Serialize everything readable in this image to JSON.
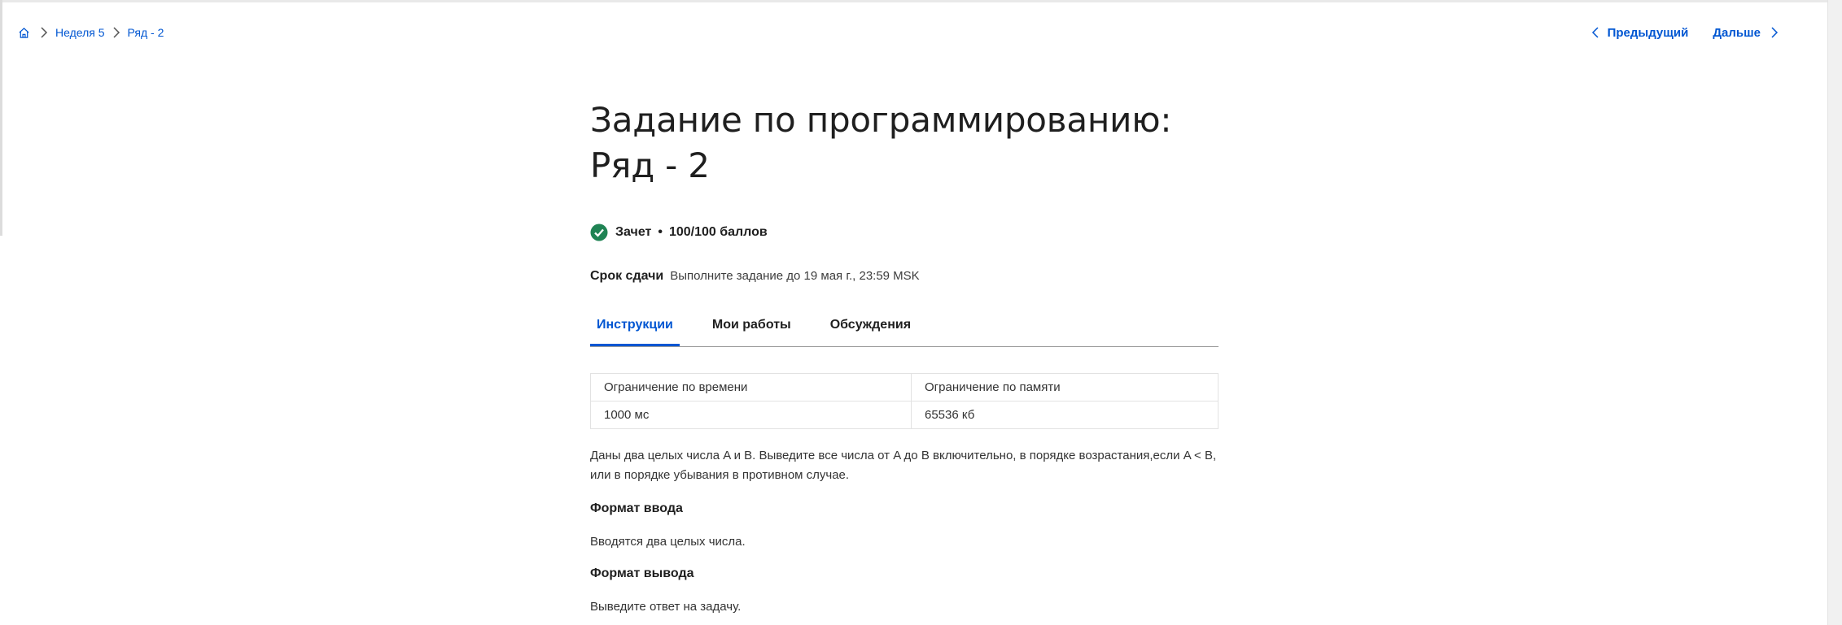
{
  "breadcrumb": {
    "home_icon": "home-icon",
    "items": [
      "Неделя 5",
      "Ряд - 2"
    ]
  },
  "pager": {
    "prev_label": "Предыдущий",
    "next_label": "Дальше"
  },
  "title": "Задание по программированию: Ряд - 2",
  "status": {
    "icon": "check-circle-icon",
    "label": "Зачет",
    "separator": "•",
    "score": "100/100 баллов"
  },
  "deadline": {
    "label": "Срок сдачи",
    "value": "Выполните задание до 19 мая г., 23:59 MSK"
  },
  "tabs": [
    {
      "label": "Инструкции",
      "active": true
    },
    {
      "label": "Мои работы",
      "active": false
    },
    {
      "label": "Обсуждения",
      "active": false
    }
  ],
  "limits": {
    "headers": [
      "Ограничение по времени",
      "Ограничение по памяти"
    ],
    "values": [
      "1000 мс",
      "65536 кб"
    ]
  },
  "description": "Даны два целых числа A и B. Выведите все числа от A до B включительно, в порядке возрастания,если A < B, или в порядке убывания в противном случае.",
  "input_format": {
    "heading": "Формат ввода",
    "text": "Вводятся два целых числа."
  },
  "output_format": {
    "heading": "Формат вывода",
    "text": "Выведите ответ на задачу."
  },
  "colors": {
    "accent": "#0056d2",
    "success": "#1f8354",
    "text": "#1f1f1f"
  }
}
